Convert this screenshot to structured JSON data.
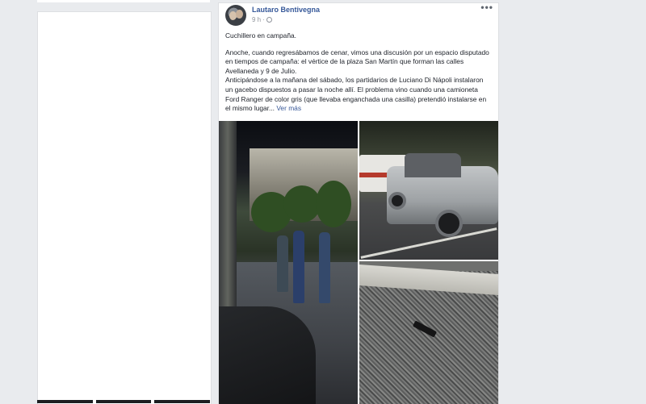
{
  "post": {
    "author": "Lautaro Bentivegna",
    "time": "9 h",
    "privacy_icon": "globe-icon",
    "more_label": "•••",
    "title": "Cuchillero en campaña.",
    "paragraph1": "Anoche, cuando regresábamos de cenar, vimos una discusión por un espacio disputado en tiempos de campaña: el vértice de la plaza San Martín que forman las calles Avellaneda y 9 de Julio.",
    "paragraph2": "Anticipándose a la mañana del sábado, los partidarios de Luciano Di Nápoli instalaron un gacebo dispuestos a pasar la noche allí. El problema vino cuando una camioneta Ford Ranger de color gris (que llevaba enganchada una casilla) pretendió instalarse en el mismo lugar...",
    "see_more": "Ver más"
  },
  "colors": {
    "page_bg": "#e9ebee",
    "author_link": "#365899",
    "see_more_link": "#385898",
    "meta_text": "#90949c"
  }
}
